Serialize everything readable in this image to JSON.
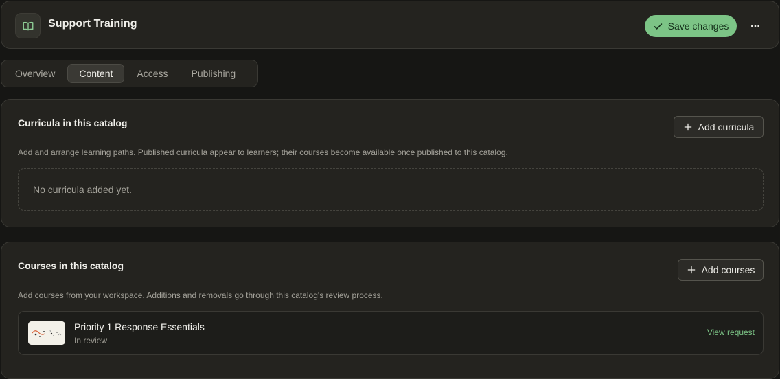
{
  "header": {
    "title": "Support Training",
    "app_icon": "open-book-icon",
    "save_label": "Save changes",
    "save_icon": "check-icon",
    "more_icon": "more-horizontal-icon"
  },
  "tabs": [
    {
      "label": "Overview",
      "active": false
    },
    {
      "label": "Content",
      "active": true
    },
    {
      "label": "Access",
      "active": false
    },
    {
      "label": "Publishing",
      "active": false
    }
  ],
  "curricula": {
    "title": "Curricula in this catalog",
    "add_label": "Add curricula",
    "description": "Add and arrange learning paths. Published curricula appear to learners; their courses become available once published to this catalog.",
    "empty_text": "No curricula added yet."
  },
  "courses": {
    "title": "Courses in this catalog",
    "add_label": "Add courses",
    "description": "Add courses from your workspace. Additions and removals go through this catalog's review process.",
    "items": [
      {
        "title": "Priority 1 Response Essentials",
        "status": "In review",
        "action": "View request"
      }
    ]
  },
  "colors": {
    "accent": "#7cc486",
    "background": "#161614",
    "card": "#24231f"
  }
}
